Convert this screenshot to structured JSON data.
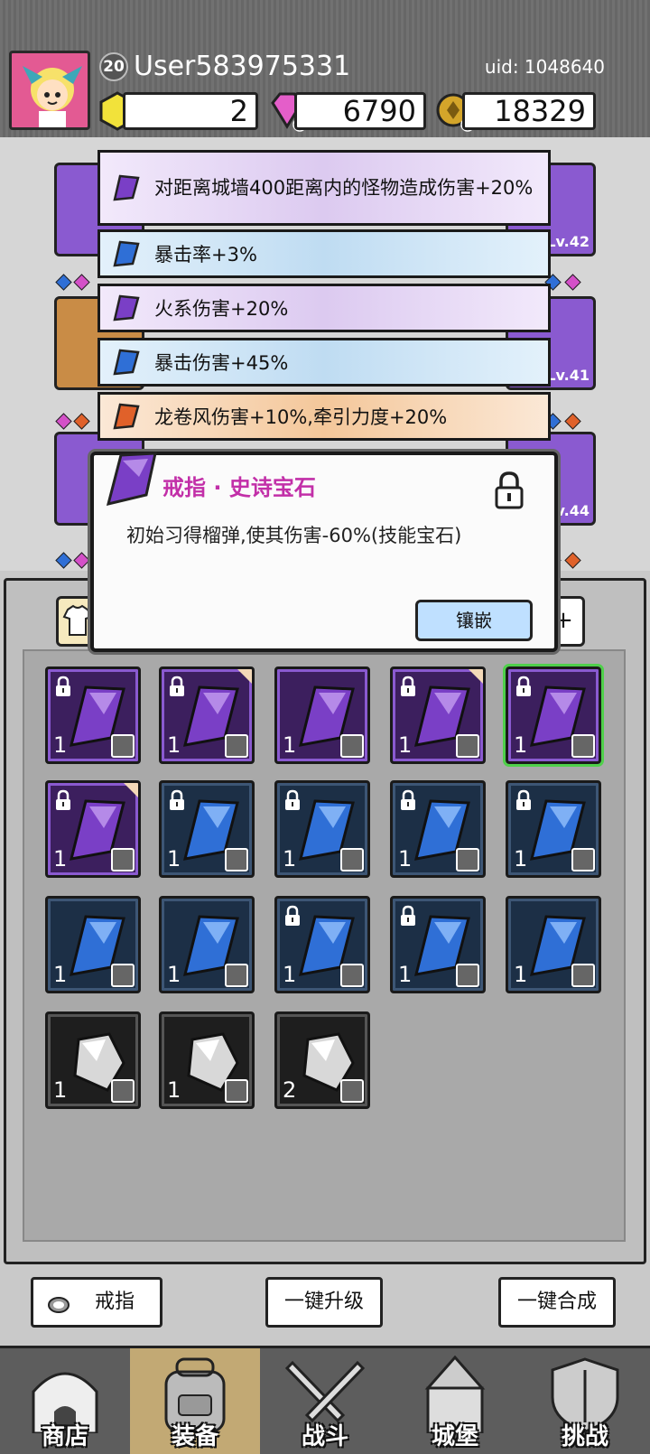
{
  "header": {
    "level": "20",
    "username": "User583975331",
    "uid": "uid: 1048640",
    "currencies": {
      "gold_gem": "2",
      "diamond": "6790",
      "coin": "18329"
    }
  },
  "equip_levels": [
    "Lv.42",
    "Lv.41",
    "Lv.44"
  ],
  "stats": [
    {
      "text": "对距离城墙400距离内的怪物造成伤害+20%",
      "color": "purple"
    },
    {
      "text": "暴击率+3%",
      "color": "blue"
    },
    {
      "text": "火系伤害+20%",
      "color": "purple"
    },
    {
      "text": "暴击伤害+45%",
      "color": "blue"
    },
    {
      "text": "龙卷风伤害+10%,牵引力度+20%",
      "color": "orange"
    }
  ],
  "popup": {
    "title": "戒指 · 史诗宝石",
    "description": "初始习得榴弹,使其伤害-60%(技能宝石)",
    "embed_button": "镶嵌"
  },
  "inventory_tab_right": "+",
  "inventory": [
    {
      "type": "purple",
      "count": "1",
      "locked": true,
      "tag": false
    },
    {
      "type": "purple",
      "count": "1",
      "locked": true,
      "tag": true
    },
    {
      "type": "purple",
      "count": "1",
      "locked": false,
      "tag": false
    },
    {
      "type": "purple",
      "count": "1",
      "locked": true,
      "tag": true
    },
    {
      "type": "purple",
      "count": "1",
      "locked": true,
      "tag": false,
      "selected": true
    },
    {
      "type": "purple",
      "count": "1",
      "locked": true,
      "tag": true
    },
    {
      "type": "blue",
      "count": "1",
      "locked": true,
      "tag": false
    },
    {
      "type": "blue",
      "count": "1",
      "locked": true,
      "tag": false
    },
    {
      "type": "blue",
      "count": "1",
      "locked": true,
      "tag": false
    },
    {
      "type": "blue",
      "count": "1",
      "locked": true,
      "tag": false
    },
    {
      "type": "blue",
      "count": "1",
      "locked": false,
      "tag": false
    },
    {
      "type": "blue",
      "count": "1",
      "locked": false,
      "tag": false
    },
    {
      "type": "blue",
      "count": "1",
      "locked": true,
      "tag": false
    },
    {
      "type": "blue",
      "count": "1",
      "locked": true,
      "tag": false
    },
    {
      "type": "blue",
      "count": "1",
      "locked": false,
      "tag": false
    },
    {
      "type": "gray",
      "count": "1",
      "locked": false,
      "tag": false
    },
    {
      "type": "gray",
      "count": "1",
      "locked": false,
      "tag": false
    },
    {
      "type": "gray",
      "count": "2",
      "locked": false,
      "tag": false
    }
  ],
  "actions": {
    "filter": "戒指",
    "upgrade_all": "一键升级",
    "merge_all": "一键合成"
  },
  "nav": [
    {
      "label": "商店",
      "icon": "shop-icon"
    },
    {
      "label": "装备",
      "icon": "backpack-icon",
      "active": true
    },
    {
      "label": "战斗",
      "icon": "swords-icon"
    },
    {
      "label": "城堡",
      "icon": "castle-icon"
    },
    {
      "label": "挑战",
      "icon": "shield-icon"
    }
  ],
  "colors": {
    "purple_gem": "#7a3fc6",
    "blue_gem": "#2f6fd6",
    "orange_gem": "#e0612a",
    "popup_title": "#c22fa8",
    "selected_outline": "#4fd04a",
    "active_tab": "#c2a974"
  }
}
